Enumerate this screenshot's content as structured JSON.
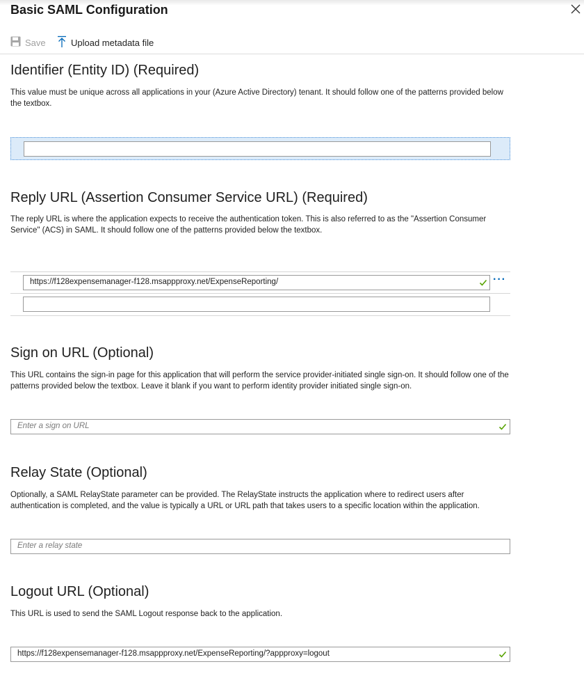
{
  "panel": {
    "title": "Basic SAML Configuration",
    "close_icon": "close-icon"
  },
  "toolbar": {
    "save_label": "Save",
    "upload_label": "Upload metadata file"
  },
  "identifier": {
    "heading": "Identifier (Entity ID) (Required)",
    "description": "This value must be unique across all applications in your (Azure Active Directory) tenant. It should follow one of the patterns provided below the textbox.",
    "value": ""
  },
  "reply": {
    "heading": "Reply URL (Assertion Consumer Service URL) (Required)",
    "description": "The reply URL is where the application expects to receive the authentication token. This is also referred to as the \"Assertion Consumer Service\" (ACS) in SAML. It should follow one of the patterns provided below the textbox.",
    "value": "https://f128expensemanager-f128.msappproxy.net/ExpenseReporting/",
    "more_label": "···",
    "empty_value": ""
  },
  "signon": {
    "heading": "Sign on URL (Optional)",
    "description": "This URL contains the sign-in page for this application that will perform the service provider-initiated single sign-on. It should follow one of the patterns provided below the textbox. Leave it blank if you want to perform identity provider initiated single sign-on.",
    "placeholder": "Enter a sign on URL"
  },
  "relay": {
    "heading": "Relay State (Optional)",
    "description": "Optionally, a SAML RelayState parameter can be provided. The RelayState instructs the application where to redirect users after authentication is completed, and the value is typically a URL or URL path that takes users to a specific location within the application.",
    "placeholder": "Enter a relay state"
  },
  "logout": {
    "heading": "Logout URL (Optional)",
    "description": "This URL is used to send the SAML Logout response back to the application.",
    "value": "https://f128expensemanager-f128.msappproxy.net/ExpenseReporting/?appproxy=logout"
  },
  "colors": {
    "accent": "#0067b8",
    "valid_check": "#57a300",
    "selection_bg": "#dcebf9"
  }
}
